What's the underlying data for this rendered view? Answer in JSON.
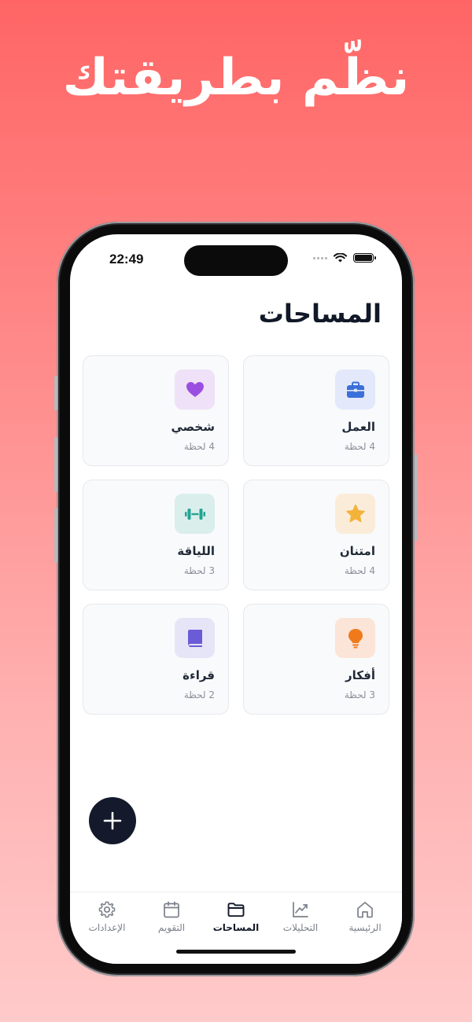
{
  "headline": "نظّم بطريقتك",
  "status_bar": {
    "time": "22:49"
  },
  "page_title": "المساحات",
  "spaces": [
    {
      "name": "العمل",
      "count": "4 لحظة",
      "icon": "briefcase-icon",
      "icon_bg": "#e3e9fb",
      "icon_color": "#3b6fd9"
    },
    {
      "name": "شخصي",
      "count": "4 لحظة",
      "icon": "heart-icon",
      "icon_bg": "#efe1f7",
      "icon_color": "#9b4fe0"
    },
    {
      "name": "امتنان",
      "count": "4 لحظة",
      "icon": "star-icon",
      "icon_bg": "#fbecd9",
      "icon_color": "#f3b23a"
    },
    {
      "name": "اللياقة",
      "count": "3 لحظة",
      "icon": "dumbbell-icon",
      "icon_bg": "#daeeec",
      "icon_color": "#23a393"
    },
    {
      "name": "أفكار",
      "count": "3 لحظة",
      "icon": "lightbulb-icon",
      "icon_bg": "#fbe4d8",
      "icon_color": "#f07a1b"
    },
    {
      "name": "قراءة",
      "count": "2 لحظة",
      "icon": "book-icon",
      "icon_bg": "#e6e5f8",
      "icon_color": "#6a5cd6"
    }
  ],
  "tabs": [
    {
      "label": "الرئيسية",
      "icon": "home-icon",
      "active": false
    },
    {
      "label": "التحليلات",
      "icon": "chart-icon",
      "active": false
    },
    {
      "label": "المساحات",
      "icon": "folder-icon",
      "active": true
    },
    {
      "label": "التقويم",
      "icon": "calendar-icon",
      "active": false
    },
    {
      "label": "الإعدادات",
      "icon": "gear-icon",
      "active": false
    }
  ],
  "colors": {
    "accent": "#141a2b",
    "background_top": "#ff6565",
    "background_bottom": "#ffcaca"
  }
}
